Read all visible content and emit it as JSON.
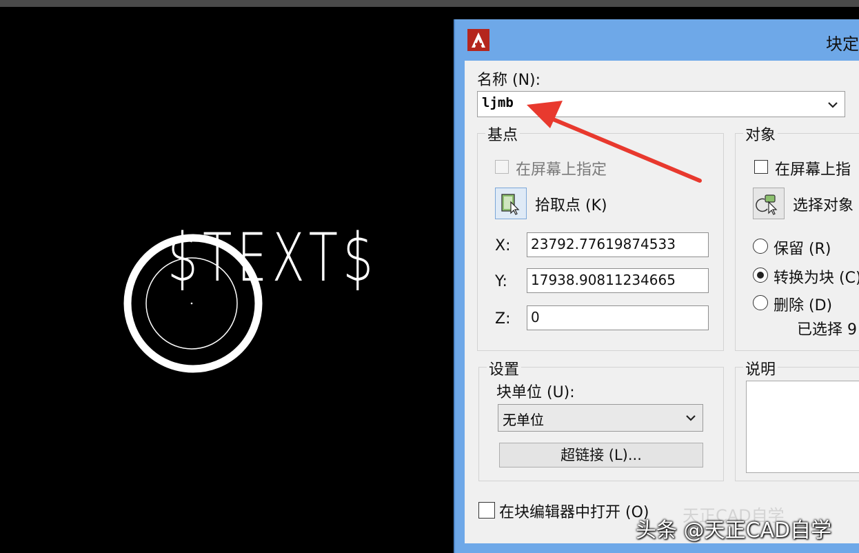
{
  "dialog": {
    "title": "块定",
    "name": {
      "label": "名称 (N):",
      "value": "ljmb"
    },
    "base_point": {
      "group_title": "基点",
      "specify_on_screen": "在屏幕上指定",
      "pick_point": "拾取点 (K)",
      "x_label": "X:",
      "x_value": "23792.77619874533",
      "y_label": "Y:",
      "y_value": "17938.90811234665",
      "z_label": "Z:",
      "z_value": "0"
    },
    "objects": {
      "group_title": "对象",
      "specify_on_screen": "在屏幕上指",
      "select_objects": "选择对象",
      "retain": "保留 (R)",
      "convert_to_block": "转换为块 (C)",
      "delete": "删除 (D)",
      "selected_count": "已选择 9"
    },
    "settings": {
      "group_title": "设置",
      "block_unit_label": "块单位 (U):",
      "block_unit_value": "无单位",
      "hyperlink": "超链接 (L)..."
    },
    "description": {
      "group_title": "说明"
    },
    "open_in_editor": "在块编辑器中打开 (O)"
  },
  "canvas": {
    "text": "$TEXT$"
  },
  "watermark": {
    "text": "头条 @天正CAD自学",
    "behind": "天正CAD自学"
  },
  "colors": {
    "dialog_frame": "#6ea8e8",
    "canvas_bg": "#000000",
    "arrow": "#e8392e"
  }
}
